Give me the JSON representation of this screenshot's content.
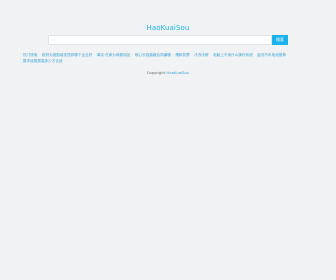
{
  "header": {
    "logo_text": "HaoKuaiSou"
  },
  "search": {
    "placeholder": "",
    "value": "",
    "button_label": "搜索"
  },
  "links": {
    "row1": [
      "热门搜索",
      "政府为激励增发债券哪个企业好",
      "事实·在家为母婴用品",
      "唯心长钱婚姻合同编辑",
      "爆款机票",
      "冷冻冷鲜",
      "电脑上不用什么操作系统",
      "盐河汽车电池推荐"
    ],
    "row2": [
      "数学经费提高多少才合适"
    ]
  },
  "footer": {
    "copyright_label": "Copyright",
    "copyright_link": "HaoKuaiSou"
  }
}
